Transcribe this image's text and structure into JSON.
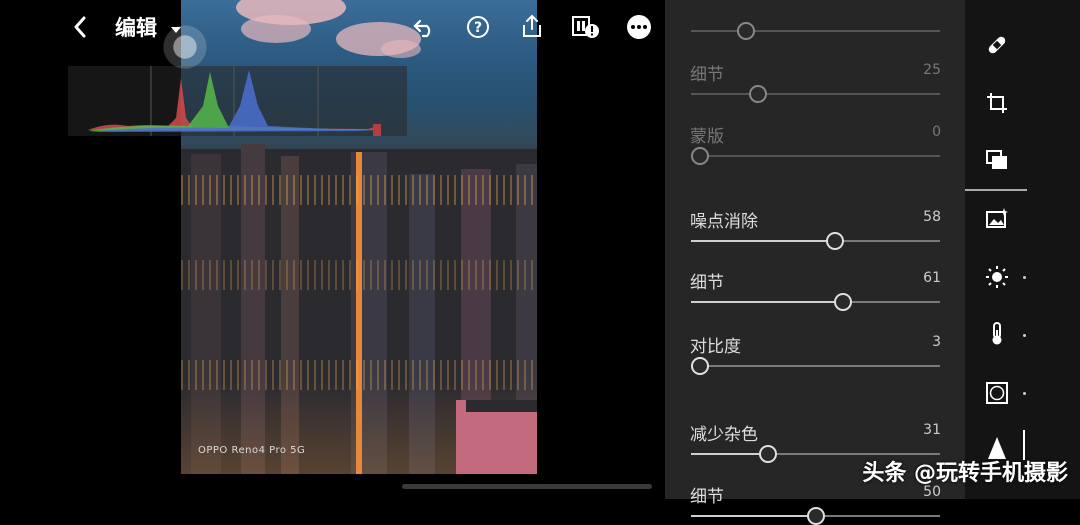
{
  "header": {
    "back_icon": "chevron-left-icon",
    "title": "编辑",
    "title_dropdown_icon": "caret-down-icon",
    "actions": [
      "undo-icon",
      "help-icon",
      "share-icon",
      "flag-alert-icon",
      "more-icon"
    ]
  },
  "photo": {
    "camera_watermark": "OPPO Reno4 Pro 5G"
  },
  "histogram": {
    "channels": [
      "red",
      "green",
      "blue"
    ]
  },
  "detail_panel": {
    "sliders": [
      {
        "label": "",
        "value": "",
        "level": 0.22,
        "enabled": false
      },
      {
        "label": "细节",
        "value": "25",
        "level": 0.27,
        "enabled": false
      },
      {
        "label": "蒙版",
        "value": "0",
        "level": 0.0,
        "enabled": false
      },
      {
        "label": "噪点消除",
        "value": "58",
        "level": 0.58,
        "enabled": true
      },
      {
        "label": "细节",
        "value": "61",
        "level": 0.61,
        "enabled": true
      },
      {
        "label": "对比度",
        "value": "3",
        "level": 0.03,
        "enabled": true
      },
      {
        "label": "减少杂色",
        "value": "31",
        "level": 0.31,
        "enabled": true
      },
      {
        "label": "细节",
        "value": "50",
        "level": 0.5,
        "enabled": true
      }
    ]
  },
  "toolbar": {
    "tools": [
      "healing-bandage-icon",
      "crop-rotate-icon",
      "presets-icon",
      "auto-image-icon",
      "light-sun-icon",
      "color-thermometer-icon",
      "effects-vignette-icon",
      "detail-triangle-icon"
    ]
  },
  "overlay": {
    "source_watermark": "头条 @玩转手机摄影"
  },
  "colors": {
    "panel_bg": "#262626",
    "toolbar_bg": "#141414",
    "accent": "#ffffff"
  }
}
